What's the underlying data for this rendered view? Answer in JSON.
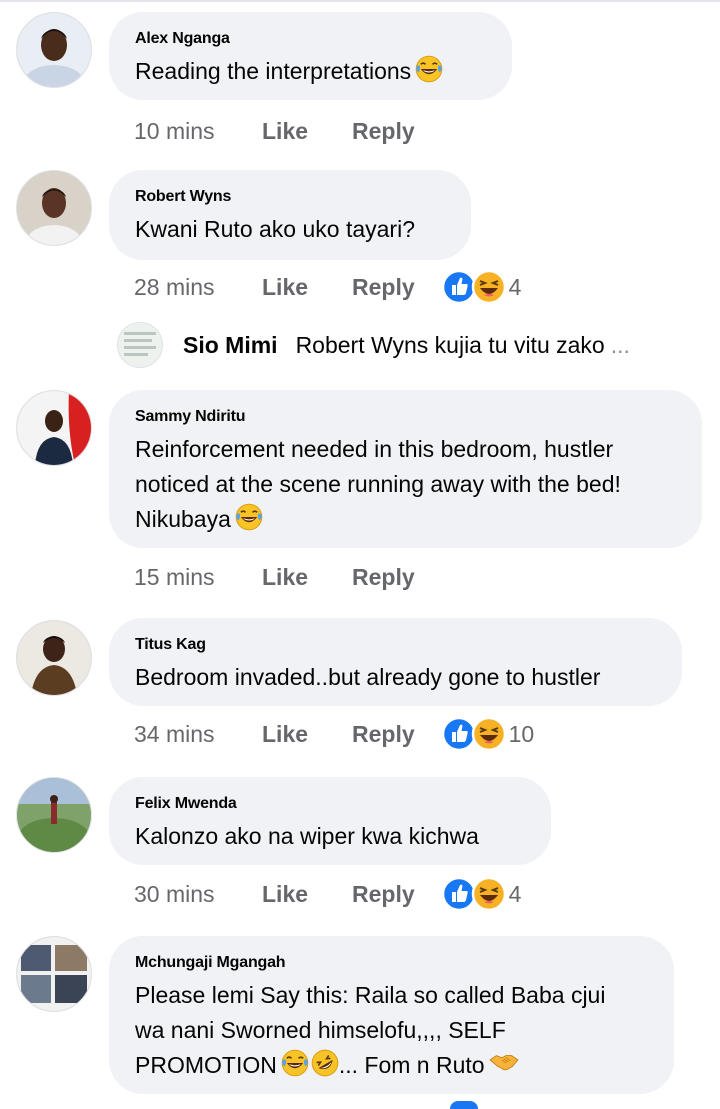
{
  "comments": [
    {
      "author": "Alex Nganga",
      "text": "Reading the interpretations",
      "time": "10 mins",
      "like": "Like",
      "reply": "Reply"
    },
    {
      "author": "Robert Wyns",
      "text": "Kwani Ruto ako uko tayari?",
      "time": "28 mins",
      "like": "Like",
      "reply": "Reply",
      "reaction_count": "4",
      "reply_preview": {
        "author": "Sio Mimi",
        "text": "Robert Wyns kujia tu  vitu zako",
        "more": "..."
      }
    },
    {
      "author": "Sammy Ndiritu",
      "text_lines": [
        "Reinforcement needed in this bedroom, hustler",
        "noticed at the scene running away with the bed!",
        "Nikubaya"
      ],
      "time": "15 mins",
      "like": "Like",
      "reply": "Reply"
    },
    {
      "author": "Titus Kag",
      "text": "Bedroom invaded..but already gone to hustler",
      "time": "34 mins",
      "like": "Like",
      "reply": "Reply",
      "reaction_count": "10"
    },
    {
      "author": "Felix Mwenda",
      "text": "Kalonzo ako na wiper kwa kichwa",
      "time": "30 mins",
      "like": "Like",
      "reply": "Reply",
      "reaction_count": "4"
    },
    {
      "author": "Mchungaji Mgangah",
      "text_lines": [
        "Please lemi Say this: Raila so called Baba cjui",
        "wa nani Sworned himselofu,,,, SELF",
        "PROMOTION",
        "... Fom n Ruto"
      ]
    }
  ],
  "icons": {
    "laugh": "laughing-face-emoji",
    "rofl": "rolling-laughing-emoji",
    "handshake": "handshake-emoji",
    "like_reaction": "thumbs-up-reaction",
    "haha_reaction": "haha-reaction"
  },
  "colors": {
    "bubble": "#f0f2f5",
    "meta_text": "#65676b",
    "like_blue": "#1877f2",
    "haha_yellow": "#f7b125"
  }
}
